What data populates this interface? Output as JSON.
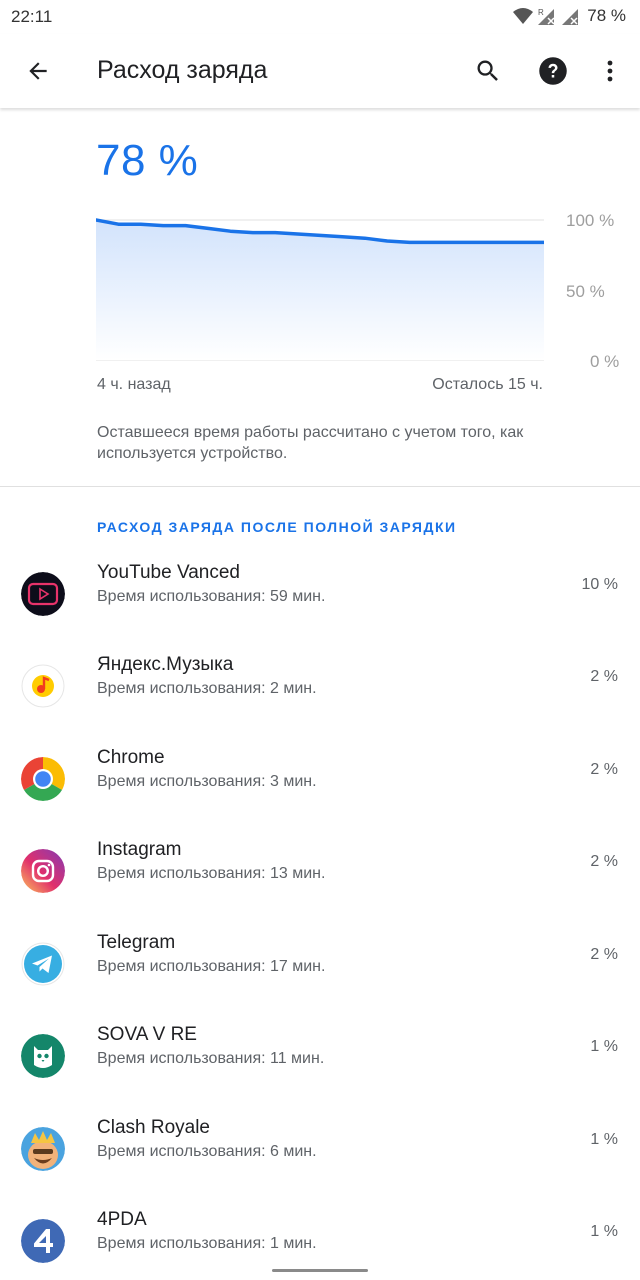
{
  "status_bar": {
    "time": "22:11",
    "battery": "78 %",
    "roaming_mark": "R"
  },
  "app_bar": {
    "title": "Расход заряда"
  },
  "battery": {
    "level": "78 %",
    "chart": {
      "ticks": [
        "100 %",
        "50 %",
        "0 %"
      ],
      "left_label": "4 ч. назад",
      "right_label": "Осталось 15 ч.",
      "line_color": "#1a73e8",
      "fill_color": "#d2e3fc"
    },
    "note": "Оставшееся время работы рассчитано с учетом того, как используется устройство."
  },
  "chart_data": {
    "type": "area",
    "x": [
      0,
      5,
      10,
      15,
      20,
      25,
      30,
      35,
      40,
      45,
      50,
      55,
      60,
      65,
      70,
      75,
      80,
      85,
      90,
      95,
      100
    ],
    "values": [
      100,
      97,
      97,
      96,
      96,
      94,
      92,
      91,
      91,
      90,
      89,
      88,
      87,
      85,
      84,
      84,
      84,
      84,
      84,
      84,
      84
    ],
    "ylim": [
      0,
      100
    ],
    "grid": true
  },
  "usage": {
    "header": "РАСХОД ЗАРЯДА ПОСЛЕ ПОЛНОЙ ЗАРЯДКИ",
    "apps": [
      {
        "name": "YouTube Vanced",
        "usage": "Время использования: 59 мин.",
        "percent": "10 %",
        "icon": "youtube-vanced-icon"
      },
      {
        "name": "Яндекс.Музыка",
        "usage": "Время использования: 2 мин.",
        "percent": "2 %",
        "icon": "yandex-music-icon"
      },
      {
        "name": "Chrome",
        "usage": "Время использования: 3 мин.",
        "percent": "2 %",
        "icon": "chrome-icon"
      },
      {
        "name": "Instagram",
        "usage": "Время использования: 13 мин.",
        "percent": "2 %",
        "icon": "instagram-icon"
      },
      {
        "name": "Telegram",
        "usage": "Время использования: 17 мин.",
        "percent": "2 %",
        "icon": "telegram-icon"
      },
      {
        "name": "SOVA V RE",
        "usage": "Время использования: 11 мин.",
        "percent": "1 %",
        "icon": "sova-icon"
      },
      {
        "name": "Clash Royale",
        "usage": "Время использования: 6 мин.",
        "percent": "1 %",
        "icon": "clash-royale-icon"
      },
      {
        "name": "4PDA",
        "usage": "Время использования: 1 мин.",
        "percent": "1 %",
        "icon": "4pda-icon"
      }
    ]
  }
}
